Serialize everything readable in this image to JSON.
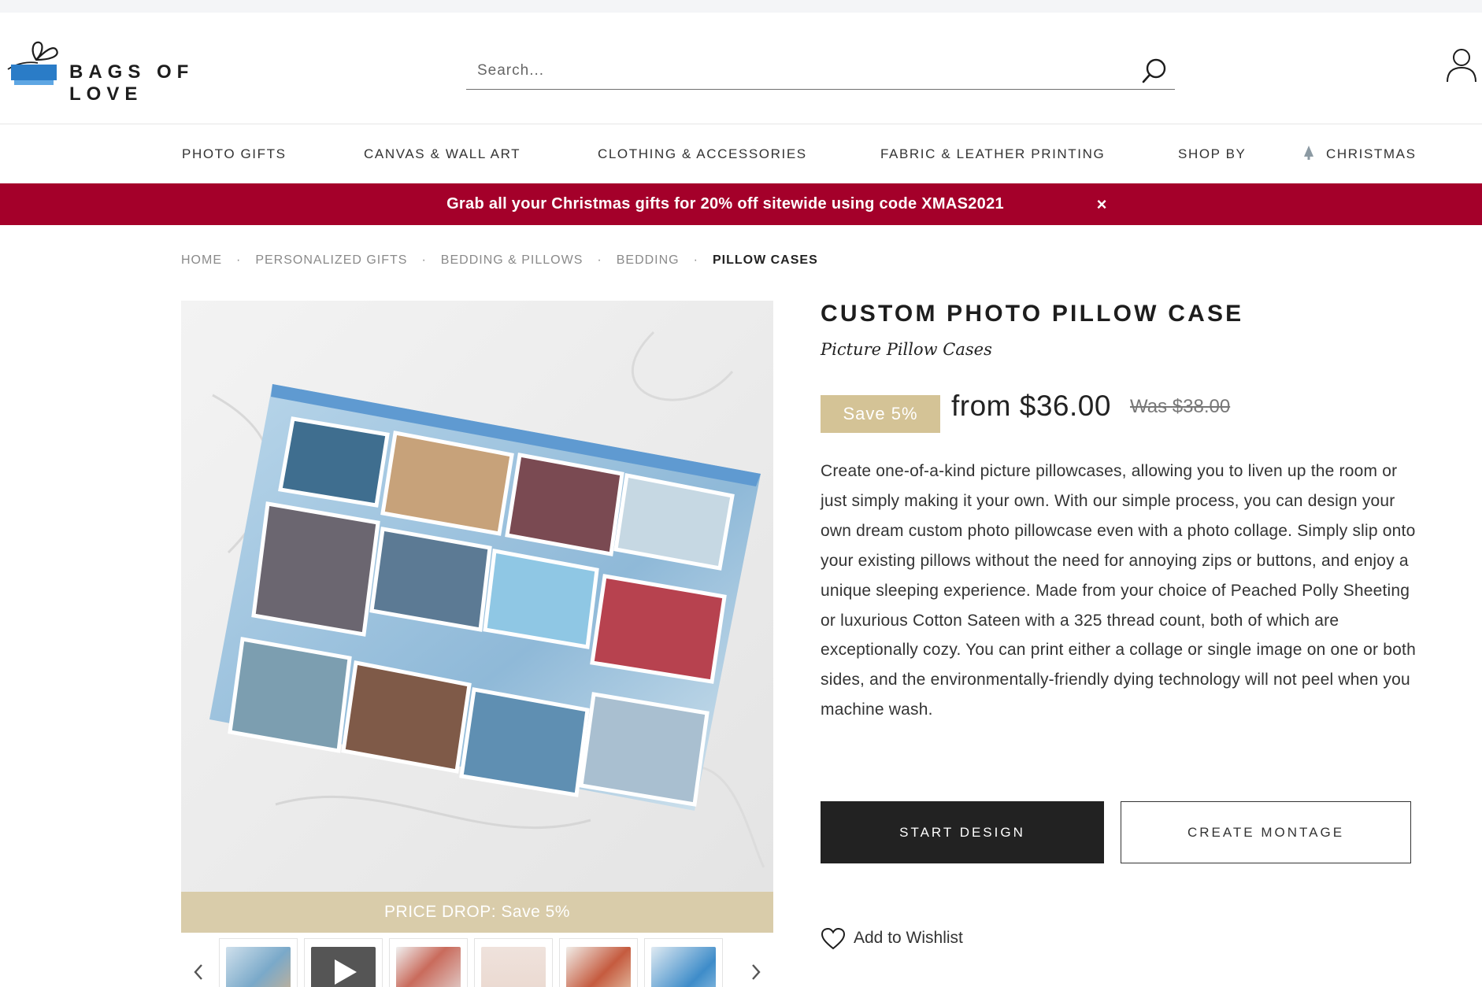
{
  "brand": {
    "name": "BAGS OF LOVE",
    "colors": {
      "blue": "#2a7cc7",
      "dark": "#1d1d1d"
    }
  },
  "search": {
    "placeholder": "Search..."
  },
  "nav": {
    "items": [
      {
        "label": "PHOTO GIFTS"
      },
      {
        "label": "CANVAS & WALL ART"
      },
      {
        "label": "CLOTHING & ACCESSORIES"
      },
      {
        "label": "FABRIC & LEATHER PRINTING"
      },
      {
        "label": "SHOP BY"
      },
      {
        "label": "CHRISTMAS",
        "icon": "christmas-tree-icon"
      }
    ]
  },
  "promo": {
    "text": "Grab all your Christmas gifts for 20% off sitewide using code XMAS2021",
    "close": "×",
    "color": "#a4002a"
  },
  "breadcrumb": {
    "items": [
      "HOME",
      "PERSONALIZED GIFTS",
      "BEDDING & PILLOWS",
      "BEDDING",
      "PILLOW CASES"
    ],
    "separator": "·"
  },
  "gallery": {
    "price_drop": "PRICE DROP: Save 5%",
    "thumbnails": [
      {
        "name": "thumb-collage-pillow"
      },
      {
        "name": "thumb-video",
        "icon": "play-icon"
      },
      {
        "name": "thumb-family-photos"
      },
      {
        "name": "thumb-andrew-lisa"
      },
      {
        "name": "thumb-photo-strip"
      },
      {
        "name": "thumb-blue-pillow"
      }
    ]
  },
  "product": {
    "title": "CUSTOM PHOTO PILLOW CASE",
    "subtitle": "Picture Pillow Cases",
    "save_badge": "Save 5%",
    "price": "from $36.00",
    "was_price": "Was $38.00",
    "description": "Create one-of-a-kind picture pillowcases, allowing you to liven up the room or just simply making it your own. With our simple process, you can design your own dream custom photo pillowcase even with a photo collage. Simply slip onto your existing pillows without the need for annoying zips or buttons, and enjoy a unique sleeping experience. Made from your choice of Peached Polly Sheeting or luxurious Cotton Sateen with a 325 thread count, both of which are exceptionally cozy. You can print either a collage or single image on one or both sides, and the environmentally-friendly dying technology will not peel when you machine wash.",
    "start_design": "START DESIGN",
    "create_montage": "CREATE MONTAGE",
    "wishlist": "Add to Wishlist",
    "badge_color": "#d4c396"
  }
}
